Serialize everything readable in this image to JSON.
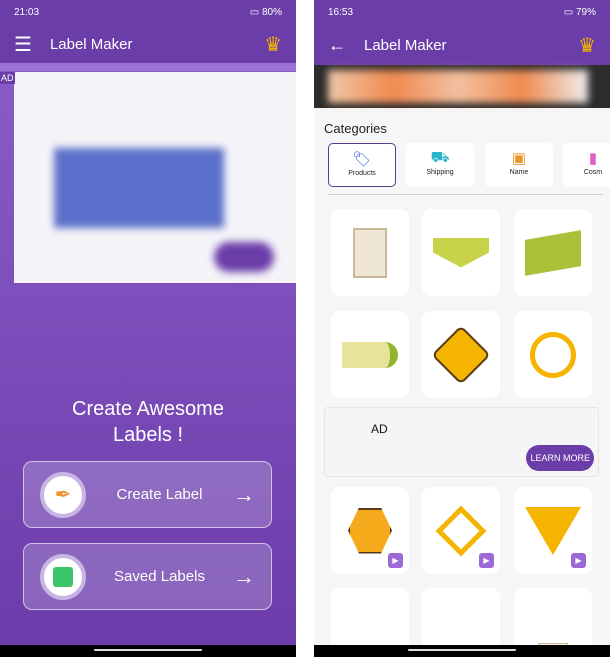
{
  "left": {
    "status": {
      "time": "21:03",
      "battery": "80"
    },
    "toolbar": {
      "title": "Label Maker"
    },
    "ad_tag": "AD",
    "heading": "Create Awesome Labels !",
    "buttons": [
      {
        "label": "Create Label",
        "icon": "pen-tool-icon"
      },
      {
        "label": "Saved Labels",
        "icon": "floppy-disk-icon"
      }
    ]
  },
  "right": {
    "status": {
      "time": "16:53",
      "battery": "79"
    },
    "toolbar": {
      "title": "Label Maker"
    },
    "categories_title": "Categories",
    "categories": [
      {
        "label": "Products",
        "icon": "tag-icon"
      },
      {
        "label": "Shipping",
        "icon": "truck-icon"
      },
      {
        "label": "Name",
        "icon": "id-card-icon"
      },
      {
        "label": "Cosm",
        "icon": "cosmetics-icon"
      }
    ],
    "ad": {
      "tag": "AD",
      "cta": "LEARN MORE"
    }
  },
  "colors": {
    "primary": "#6a3da8",
    "accent": "#f5b400"
  }
}
